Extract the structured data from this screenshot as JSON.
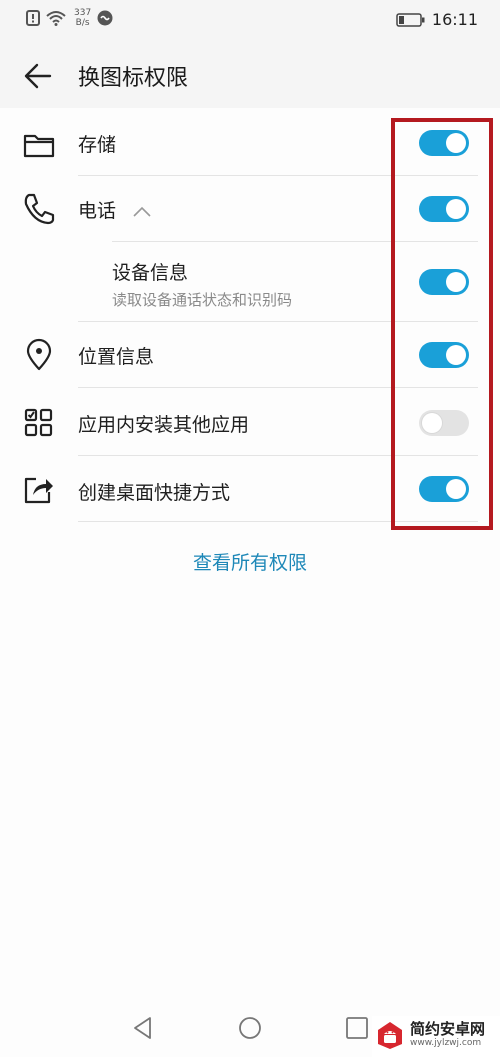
{
  "status_bar": {
    "net_speed_value": "337",
    "net_speed_unit": "B/s",
    "time": "16:11",
    "icons": [
      "alert-icon",
      "wifi-icon",
      "sync-icon",
      "battery-icon"
    ]
  },
  "header": {
    "title": "换图标权限",
    "back_icon": "arrow-left-icon"
  },
  "permissions": [
    {
      "label": "存储",
      "icon": "folder-icon",
      "enabled": true
    },
    {
      "label": "电话",
      "icon": "phone-icon",
      "enabled": true,
      "expanded": true
    },
    {
      "label": "设备信息",
      "description": "读取设备通话状态和识别码",
      "enabled": true,
      "indent": true
    },
    {
      "label": "位置信息",
      "icon": "location-pin-icon",
      "enabled": true
    },
    {
      "label": "应用内安装其他应用",
      "icon": "apps-grid-icon",
      "enabled": false
    },
    {
      "label": "创建桌面快捷方式",
      "icon": "share-shortcut-icon",
      "enabled": true
    }
  ],
  "view_all_link": "查看所有权限",
  "nav_bar": [
    "back-triangle-icon",
    "home-circle-icon",
    "recents-square-icon"
  ],
  "watermark": {
    "name": "简约安卓网",
    "url": "www.jylzwj.com"
  },
  "colors": {
    "accent": "#1aa0d8",
    "link": "#1e88b8",
    "highlight_box": "#b4191f",
    "toggle_off": "#e3e3e3"
  }
}
